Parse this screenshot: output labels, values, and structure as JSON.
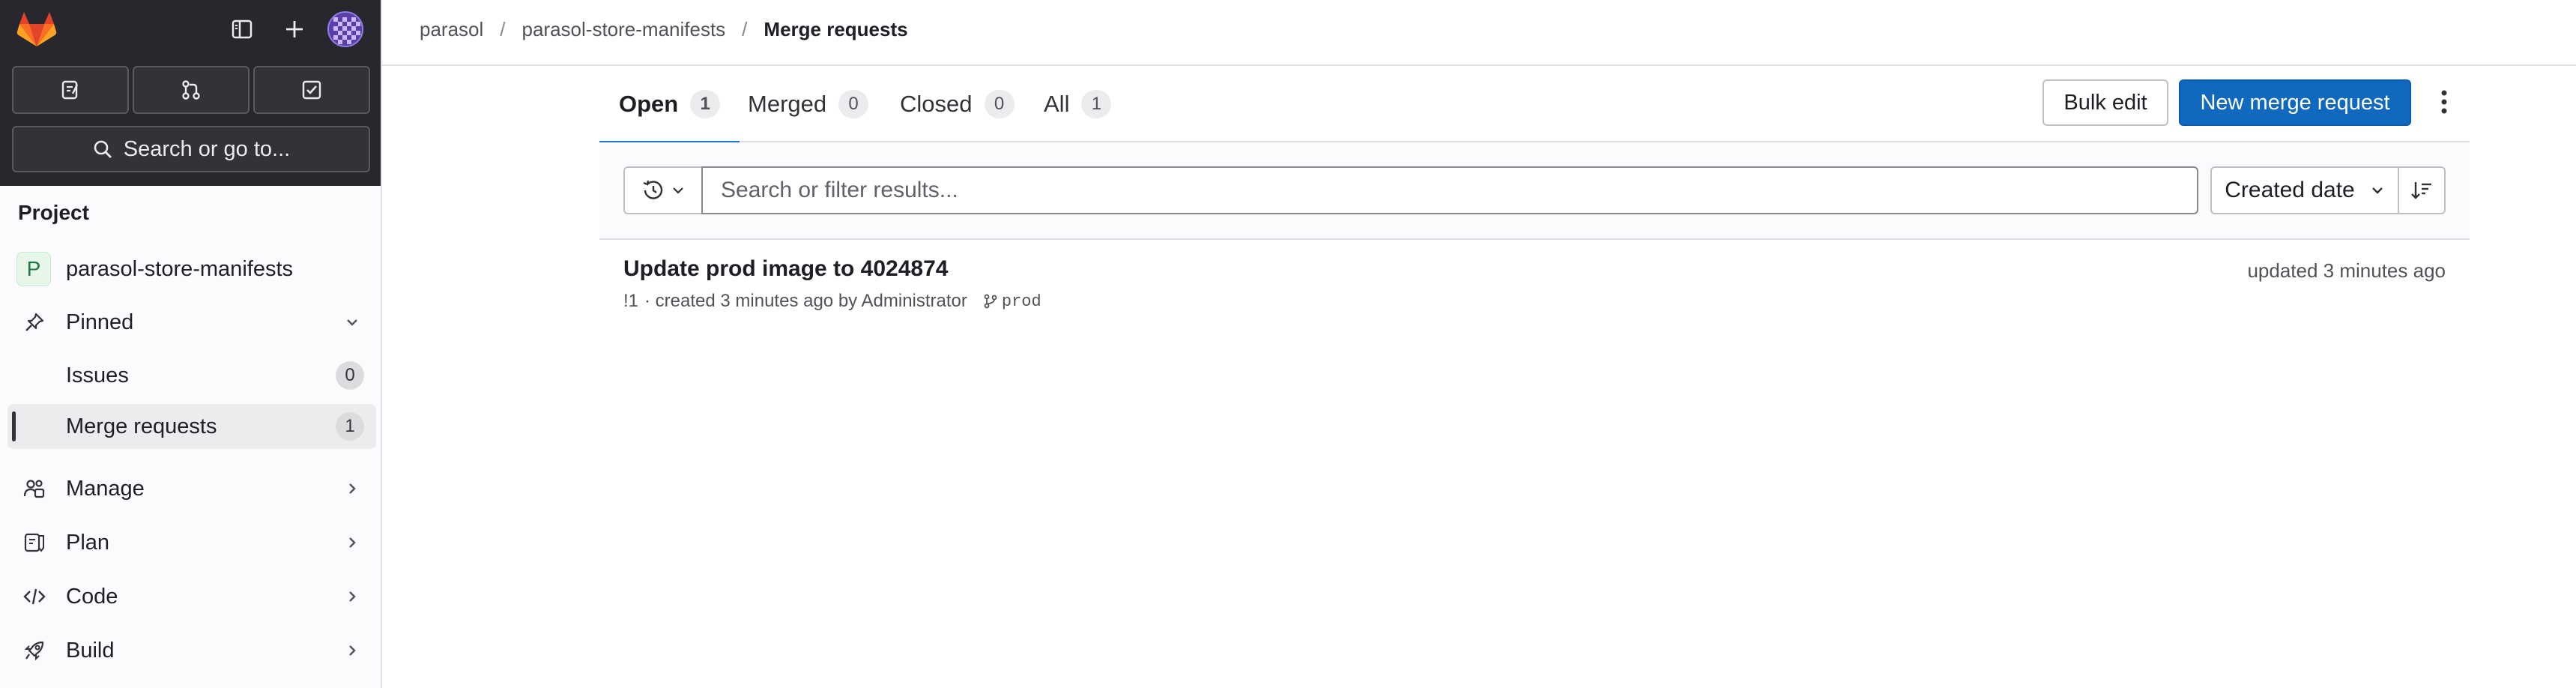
{
  "sidebar": {
    "top_tabs": [
      "Assigned issues",
      "Merge requests",
      "To-Do items"
    ],
    "search_label": "Search or go to...",
    "section_title": "Project",
    "project_initial": "P",
    "project_name": "parasol-store-manifests",
    "pinned_label": "Pinned",
    "pinned_items": [
      {
        "label": "Issues",
        "count": "0"
      },
      {
        "label": "Merge requests",
        "count": "1"
      }
    ],
    "nav_items": [
      {
        "label": "Manage",
        "icon": "users-icon"
      },
      {
        "label": "Plan",
        "icon": "planning-icon"
      },
      {
        "label": "Code",
        "icon": "code-icon"
      },
      {
        "label": "Build",
        "icon": "rocket-icon"
      }
    ]
  },
  "breadcrumb": [
    "parasol",
    "parasol-store-manifests",
    "Merge requests"
  ],
  "tabs": [
    {
      "label": "Open",
      "count": "1"
    },
    {
      "label": "Merged",
      "count": "0"
    },
    {
      "label": "Closed",
      "count": "0"
    },
    {
      "label": "All",
      "count": "1"
    }
  ],
  "actions": {
    "bulk_edit": "Bulk edit",
    "new_mr": "New merge request"
  },
  "filter": {
    "placeholder": "Search or filter results...",
    "sort_label": "Created date"
  },
  "merge_requests": [
    {
      "title": "Update prod image to 4024874",
      "ref": "!1",
      "meta": "· created 3 minutes ago by Administrator",
      "branch": "prod",
      "updated": "updated 3 minutes ago"
    }
  ],
  "colors": {
    "primary": "#1068bf",
    "active_tab_underline": "#1f75cb",
    "sidebar_dark": "#28272d"
  }
}
